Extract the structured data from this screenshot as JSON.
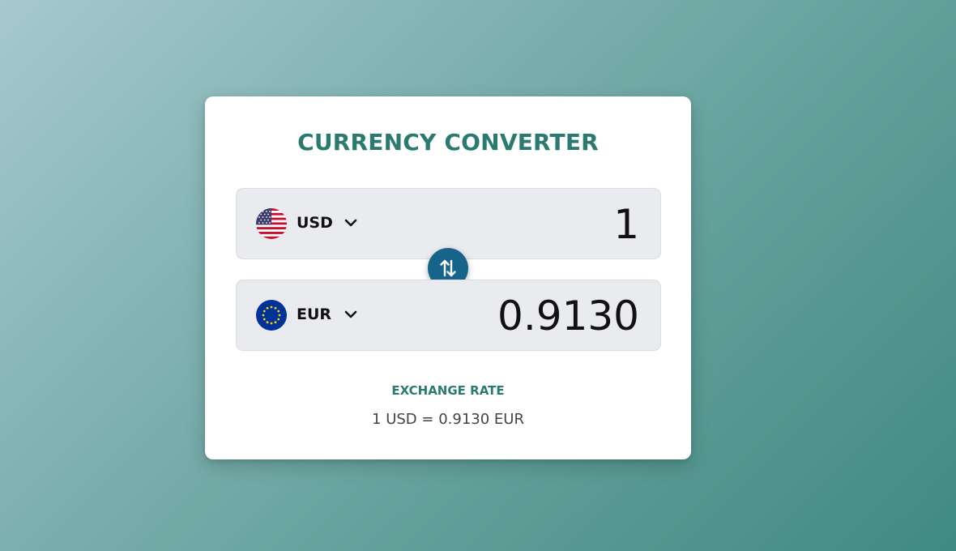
{
  "converter": {
    "title": "CURRENCY CONVERTER",
    "from": {
      "code": "USD",
      "amount": "1",
      "flag_icon": "us-flag-icon"
    },
    "to": {
      "code": "EUR",
      "amount": "0.9130",
      "flag_icon": "eu-flag-icon"
    },
    "swap_icon": "swap-arrows-icon",
    "exchange_rate_label": "EXCHANGE RATE",
    "exchange_rate_value": "1 USD = 0.9130 EUR"
  },
  "colors": {
    "accent": "#2a7a70",
    "swap_button": "#17648a",
    "field_background": "#eaebee",
    "card_background": "#ffffff"
  }
}
